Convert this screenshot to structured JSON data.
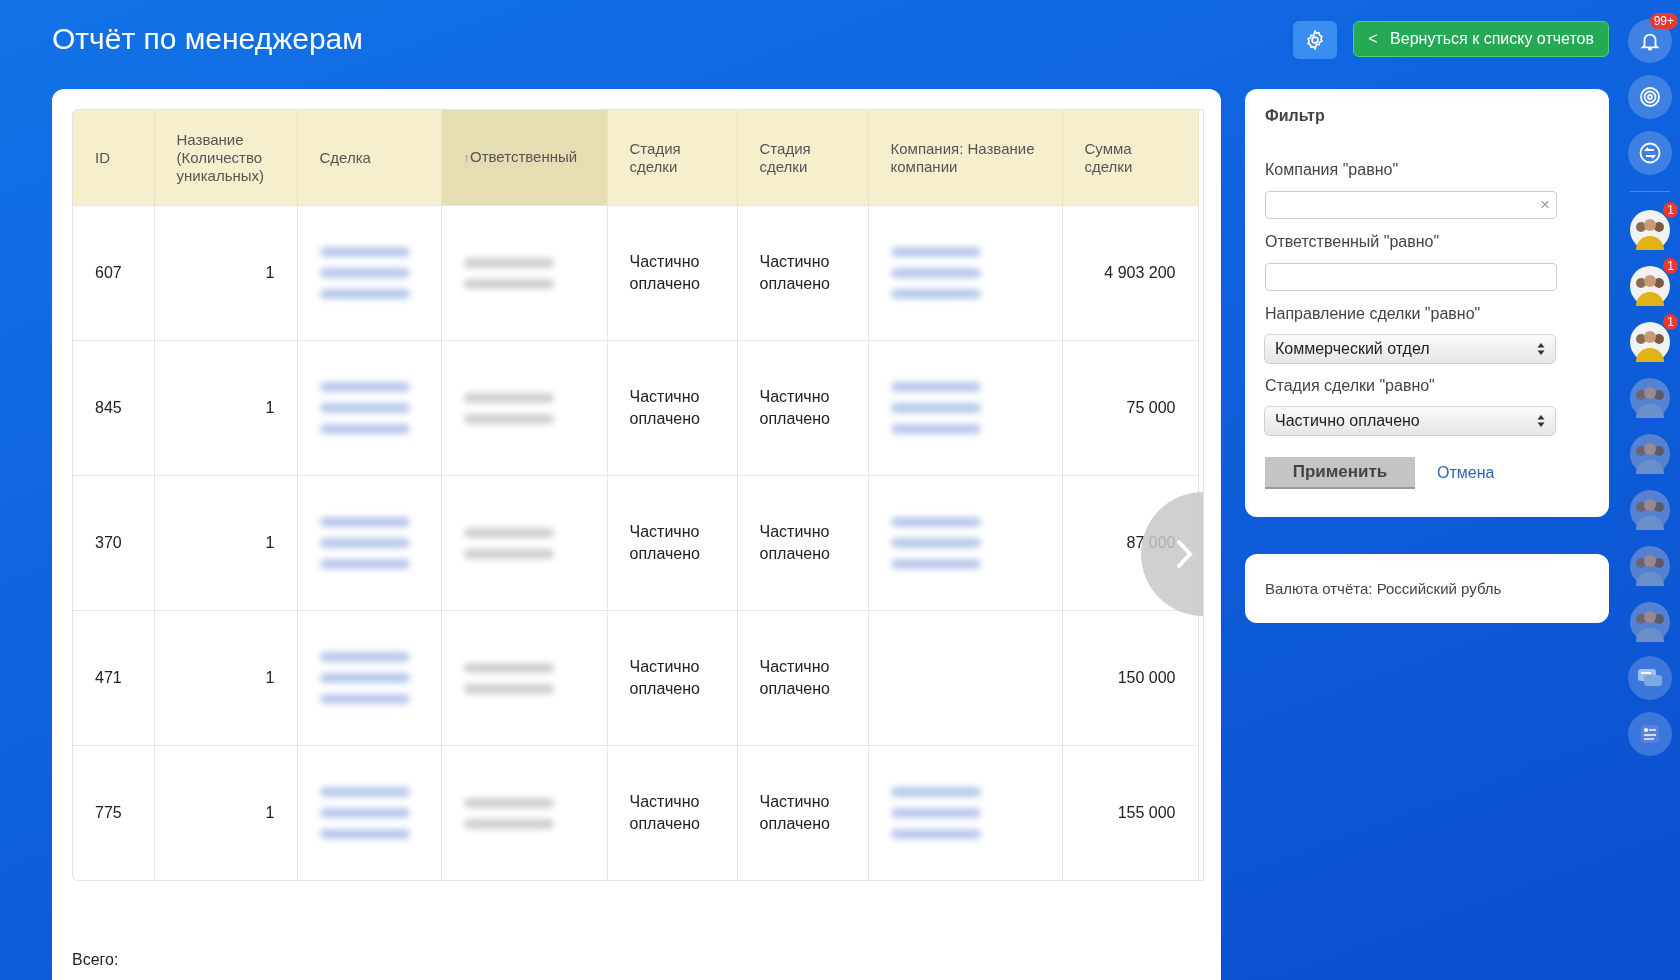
{
  "page": {
    "title": "Отчёт по менеджерам"
  },
  "toolbar": {
    "back_button": {
      "icon": "<",
      "label": "Вернуться к списку отчетов"
    }
  },
  "table": {
    "columns": [
      {
        "label": "ID",
        "selected": false
      },
      {
        "label": "Название (Количество уникальных)",
        "selected": false
      },
      {
        "label": "Сделка",
        "selected": false
      },
      {
        "label": "Ответственный",
        "sort_mark": "↑",
        "selected": true
      },
      {
        "label": "Стадия сделки",
        "selected": false
      },
      {
        "label": "Стадия сделки",
        "selected": false
      },
      {
        "label": "Компания: Название компании",
        "selected": false
      },
      {
        "label": "Сумма сделки",
        "selected": false
      }
    ],
    "rows": [
      {
        "cells": [
          {
            "kind": "text",
            "text": "607"
          },
          {
            "kind": "number",
            "text": "1"
          },
          {
            "kind": "blurlink"
          },
          {
            "kind": "blurname"
          },
          {
            "kind": "text",
            "text": "Частично оплачено"
          },
          {
            "kind": "text",
            "text": "Частично оплачено"
          },
          {
            "kind": "blurlink"
          },
          {
            "kind": "number",
            "text": "4 903 200"
          }
        ]
      },
      {
        "cells": [
          {
            "kind": "text",
            "text": "845"
          },
          {
            "kind": "number",
            "text": "1"
          },
          {
            "kind": "blurlink"
          },
          {
            "kind": "blurname"
          },
          {
            "kind": "text",
            "text": "Частично оплачено"
          },
          {
            "kind": "text",
            "text": "Частично оплачено"
          },
          {
            "kind": "blurlink"
          },
          {
            "kind": "number",
            "text": "75 000"
          }
        ]
      },
      {
        "cells": [
          {
            "kind": "text",
            "text": "370"
          },
          {
            "kind": "number",
            "text": "1"
          },
          {
            "kind": "blurlink"
          },
          {
            "kind": "blurname"
          },
          {
            "kind": "text",
            "text": "Частично оплачено"
          },
          {
            "kind": "text",
            "text": "Частично оплачено"
          },
          {
            "kind": "blurlink"
          },
          {
            "kind": "number",
            "text": "87 000"
          }
        ]
      },
      {
        "cells": [
          {
            "kind": "text",
            "text": "471"
          },
          {
            "kind": "number",
            "text": "1"
          },
          {
            "kind": "blurlink"
          },
          {
            "kind": "blurname"
          },
          {
            "kind": "text",
            "text": "Частично оплачено"
          },
          {
            "kind": "text",
            "text": "Частично оплачено"
          },
          {
            "kind": "empty"
          },
          {
            "kind": "number",
            "text": "150 000"
          }
        ]
      },
      {
        "cells": [
          {
            "kind": "text",
            "text": "775"
          },
          {
            "kind": "number",
            "text": "1"
          },
          {
            "kind": "blurlink"
          },
          {
            "kind": "blurname"
          },
          {
            "kind": "text",
            "text": "Частично оплачено"
          },
          {
            "kind": "text",
            "text": "Частично оплачено"
          },
          {
            "kind": "blurlink"
          },
          {
            "kind": "number",
            "text": "155 000"
          }
        ]
      }
    ]
  },
  "total": {
    "label": "Всего:"
  },
  "filter": {
    "title": "Фильтр",
    "fields": [
      {
        "kind": "input",
        "label": "Компания \"равно\"",
        "clear": "×"
      },
      {
        "kind": "input",
        "label": "Ответственный \"равно\""
      },
      {
        "kind": "select",
        "label": "Направление сделки \"равно\"",
        "value": "Коммерческий отдел"
      },
      {
        "kind": "select",
        "label": "Стадия сделки \"равно\"",
        "value": "Частично оплачено"
      }
    ],
    "apply": "Применить",
    "cancel": "Отмена"
  },
  "currency": {
    "text": "Валюта отчёта: Российский рубль"
  },
  "rail": [
    {
      "kind": "bell",
      "badge": "99+"
    },
    {
      "kind": "target"
    },
    {
      "kind": "exchange"
    },
    {
      "kind": "divider"
    },
    {
      "kind": "avatar",
      "badge": "1",
      "dimmed": false
    },
    {
      "kind": "avatar",
      "badge": "1",
      "dimmed": false
    },
    {
      "kind": "avatar",
      "badge": "1",
      "dimmed": false
    },
    {
      "kind": "avatar",
      "dimmed": true
    },
    {
      "kind": "avatar",
      "dimmed": true
    },
    {
      "kind": "avatar",
      "dimmed": true
    },
    {
      "kind": "avatar",
      "dimmed": true
    },
    {
      "kind": "avatar",
      "dimmed": true
    },
    {
      "kind": "chat"
    },
    {
      "kind": "document"
    }
  ]
}
